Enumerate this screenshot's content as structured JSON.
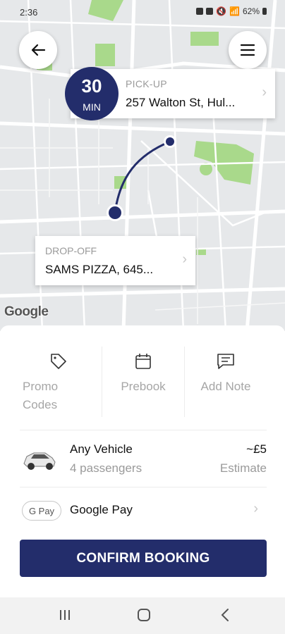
{
  "status": {
    "time": "2:36",
    "battery": "62%"
  },
  "pickup": {
    "label": "PICK-UP",
    "address": "257 Walton St, Hul..."
  },
  "eta": {
    "value": "30",
    "unit": "MIN"
  },
  "dropoff": {
    "label": "DROP-OFF",
    "address": "SAMS PIZZA, 645..."
  },
  "map": {
    "attribution": "Google",
    "route_color": "#232d6b"
  },
  "actions": [
    {
      "label": "Promo Codes",
      "icon": "tag-icon"
    },
    {
      "label": "Prebook",
      "icon": "calendar-icon"
    },
    {
      "label": "Add Note",
      "icon": "note-icon"
    }
  ],
  "vehicle": {
    "name": "Any Vehicle",
    "passengers": "4 passengers",
    "price": "~£5",
    "price_note": "Estimate"
  },
  "payment": {
    "badge": "G Pay",
    "label": "Google Pay"
  },
  "confirm_label": "CONFIRM BOOKING",
  "colors": {
    "primary": "#232d6b",
    "park_green": "#a9d98b"
  }
}
